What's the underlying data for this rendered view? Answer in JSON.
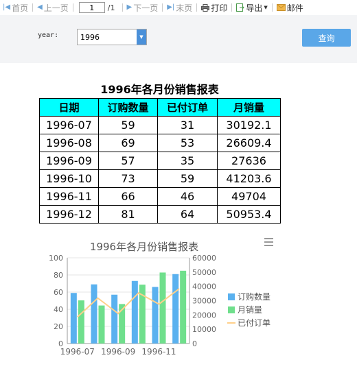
{
  "toolbar": {
    "first": "首页",
    "prev": "上一页",
    "page_value": "1",
    "page_total": "/1",
    "next": "下一页",
    "last": "末页",
    "print": "打印",
    "export": "导出",
    "mail": "邮件",
    "icons": [
      "first-page-icon",
      "prev-page-icon",
      "next-page-icon",
      "last-page-icon",
      "print-icon",
      "export-icon",
      "mail-icon"
    ]
  },
  "params": {
    "year_label": "year:",
    "year_value": "1996",
    "query_label": "查询"
  },
  "report": {
    "title": "1996年各月份销售报表",
    "headers": [
      "日期",
      "订购数量",
      "已付订单",
      "月销量"
    ],
    "rows": [
      [
        "1996-07",
        "59",
        "31",
        "30192.1"
      ],
      [
        "1996-08",
        "69",
        "53",
        "26609.4"
      ],
      [
        "1996-09",
        "57",
        "35",
        "27636"
      ],
      [
        "1996-10",
        "73",
        "59",
        "41203.6"
      ],
      [
        "1996-11",
        "66",
        "46",
        "49704"
      ],
      [
        "1996-12",
        "81",
        "64",
        "50953.4"
      ]
    ]
  },
  "colors": {
    "header_bg": "#00ffff",
    "bar_orders": "#5ab1ef",
    "bar_sales": "#6fdf8c",
    "line_paid": "#ffd08a",
    "button": "#5aa7e8"
  },
  "chart_data": {
    "type": "bar",
    "title": "1996年各月份销售报表",
    "categories": [
      "1996-07",
      "1996-08",
      "1996-09",
      "1996-10",
      "1996-11",
      "1996-12"
    ],
    "x_tick_labels": [
      "1996-07",
      "1996-09",
      "1996-11"
    ],
    "series": [
      {
        "name": "订购数量",
        "type": "bar",
        "axis": "left",
        "values": [
          59,
          69,
          57,
          73,
          66,
          81
        ]
      },
      {
        "name": "月销量",
        "type": "bar",
        "axis": "right",
        "values": [
          30192.1,
          26609.4,
          27636,
          41203.6,
          49704,
          50953.4
        ]
      },
      {
        "name": "已付订单",
        "type": "line",
        "axis": "left",
        "values": [
          31,
          53,
          35,
          59,
          46,
          64
        ]
      }
    ],
    "ylim_left": [
      0,
      100
    ],
    "ylim_right": [
      0,
      60000
    ],
    "yticks_left": [
      "0",
      "20",
      "40",
      "60",
      "80",
      "100"
    ],
    "yticks_right": [
      "0",
      "10000",
      "20000",
      "30000",
      "40000",
      "50000",
      "60000"
    ],
    "grid": true,
    "legend_position": "right"
  }
}
